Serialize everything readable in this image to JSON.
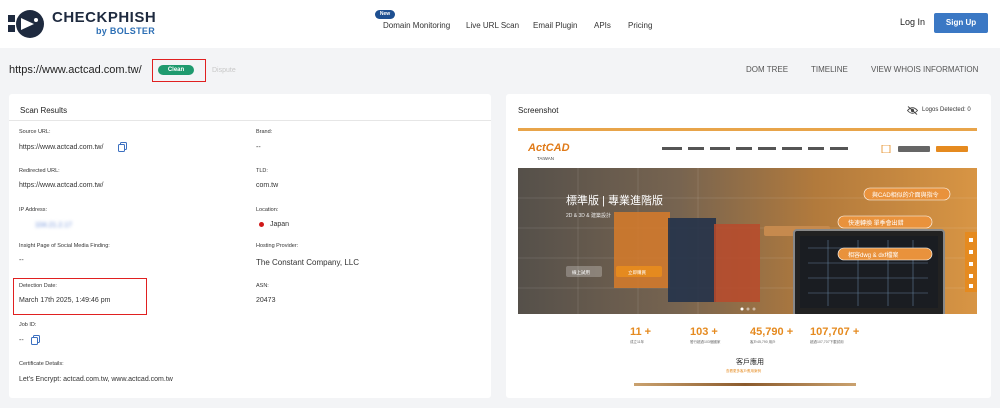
{
  "brand": {
    "name": "CHECKPHISH",
    "byline": "by BOLSTER"
  },
  "nav": {
    "new_badge": "New",
    "items": [
      "Domain Monitoring",
      "Live URL Scan",
      "Email Plugin",
      "APIs",
      "Pricing"
    ],
    "login": "Log In",
    "signup": "Sign Up"
  },
  "scan": {
    "url": "https://www.actcad.com.tw/",
    "status": "Clean",
    "dispute": "Dispute",
    "tabs": [
      "DOM TREE",
      "TIMELINE",
      "VIEW WHOIS INFORMATION"
    ]
  },
  "results": {
    "title": "Scan Results",
    "source_url_label": "Source URL:",
    "source_url": "https://www.actcad.com.tw/",
    "redirected_url_label": "Redirected URL:",
    "redirected_url": "https://www.actcad.com.tw/",
    "ip_label": "IP Address:",
    "ip": "104.21.2.17",
    "insight_label": "Insight Page of Social Media Finding:",
    "insight": "--",
    "detection_label": "Detection Date:",
    "detection": "March 17th 2025, 1:49:46 pm",
    "job_label": "Job ID:",
    "job": "--",
    "cert_label": "Certificate Details:",
    "cert": "Let's Encrypt: actcad.com.tw, www.actcad.com.tw",
    "brand_label": "Brand:",
    "brand": "--",
    "tld_label": "TLD:",
    "tld": "com.tw",
    "location_label": "Location:",
    "location": "Japan",
    "hosting_label": "Hosting Provider:",
    "hosting": "The Constant Company, LLC",
    "asn_label": "ASN:",
    "asn": "20473"
  },
  "screenshot": {
    "title": "Screenshot",
    "logos": "Logos Detected: 0",
    "site": {
      "logo_top": "ActCAD",
      "logo_sub": "TAIWAN",
      "hero_title": "標準版 | 專業進階版",
      "hero_sub": "2D & 3D & 建築設計",
      "btn_left": "線上試用",
      "btn_right": "立即購買",
      "banner_1": "與CAD相似的介面與指令",
      "banner_2": "快速轉換 單季會出錯",
      "banner_3": "相容dwg & dxf檔案",
      "stats": [
        {
          "num": "11 +",
          "sub": "成立11年"
        },
        {
          "num": "103 +",
          "sub": "發行超過103個國家"
        },
        {
          "num": "45,790 +",
          "sub": "客戶45,790 用戶"
        },
        {
          "num": "107,707 +",
          "sub": "超過107,707下載試用"
        }
      ],
      "customers": "客戶應用",
      "customers_sub": "查看更多客戶應用案例"
    }
  }
}
